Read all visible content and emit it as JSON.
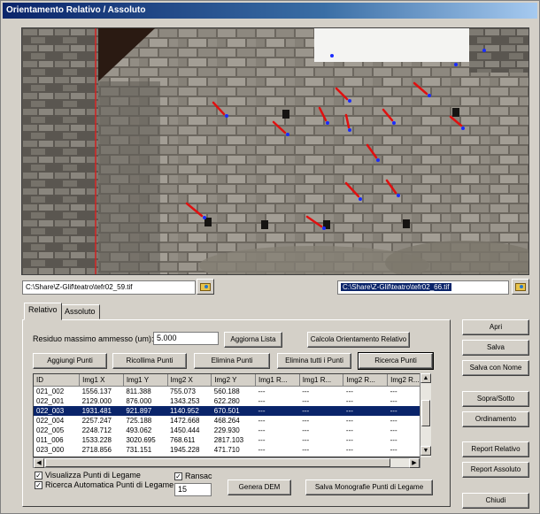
{
  "window": {
    "title": "Orientamento Relativo / Assoluto"
  },
  "images": {
    "left_path": "C:\\Share\\Z-Glif\\teatro\\tefr02_59.tif",
    "right_path": "C:\\Share\\Z-Glif\\teatro\\tefr02_66.tif"
  },
  "tabs": [
    {
      "label": "Relativo"
    },
    {
      "label": "Assoluto"
    }
  ],
  "residuo": {
    "label": "Residuo massimo ammesso (um):",
    "value": "5.000"
  },
  "buttons": {
    "aggiorna_lista": "Aggiorna Lista",
    "calcola": "Calcola Orientamento Relativo",
    "aggiungi": "Aggiungi Punti",
    "ricollima": "Ricollima Punti",
    "elimina": "Elimina Punti",
    "elimina_tutti": "Elimina tutti i Punti",
    "ricerca": "Ricerca Punti",
    "genera_dem": "Genera DEM",
    "salva_monografie": "Salva Monografie Punti di Legame"
  },
  "side_buttons": {
    "apri": "Apri",
    "salva": "Salva",
    "salva_nome": "Salva con Nome",
    "sopra_sotto": "Sopra/Sotto",
    "ordinamento": "Ordinamento",
    "report_relativo": "Report Relativo",
    "report_assoluto": "Report Assoluto",
    "chiudi": "Chiudi"
  },
  "grid": {
    "headers": [
      "ID",
      "Img1 X",
      "Img1 Y",
      "Img2 X",
      "Img2 Y",
      "Img1 R...",
      "Img1 R...",
      "Img2 R...",
      "Img2 R..."
    ],
    "rows": [
      [
        "021_002",
        "1556.137",
        "811.388",
        "755.073",
        "560.188",
        "---",
        "---",
        "---",
        "---"
      ],
      [
        "022_001",
        "2129.000",
        "876.000",
        "1343.253",
        "622.280",
        "---",
        "---",
        "---",
        "---"
      ],
      [
        "022_003",
        "1931.481",
        "921.897",
        "1140.952",
        "670.501",
        "---",
        "---",
        "---",
        "---"
      ],
      [
        "022_004",
        "2257.247",
        "725.188",
        "1472.668",
        "468.264",
        "---",
        "---",
        "---",
        "---"
      ],
      [
        "022_005",
        "2248.712",
        "493.062",
        "1450.444",
        "229.930",
        "---",
        "---",
        "---",
        "---"
      ],
      [
        "011_006",
        "1533.228",
        "3020.695",
        "768.611",
        "2817.103",
        "---",
        "---",
        "---",
        "---"
      ],
      [
        "023_000",
        "2718.856",
        "731.151",
        "1945.228",
        "471.710",
        "---",
        "---",
        "---",
        "---"
      ]
    ],
    "selected_index": 2
  },
  "options": {
    "visualizza": {
      "label": "Visualizza Punti di Legame",
      "checked": true
    },
    "ricerca_auto": {
      "label": "Ricerca Automatica Punti di Legame",
      "checked": true
    },
    "ransac": {
      "label": "Ransac",
      "checked": true,
      "value": "15"
    }
  },
  "colors": {
    "title_start": "#0a246a",
    "selection": "#0a246a",
    "marker_arrow": "#e01010",
    "marker_point": "#1a2cff"
  }
}
